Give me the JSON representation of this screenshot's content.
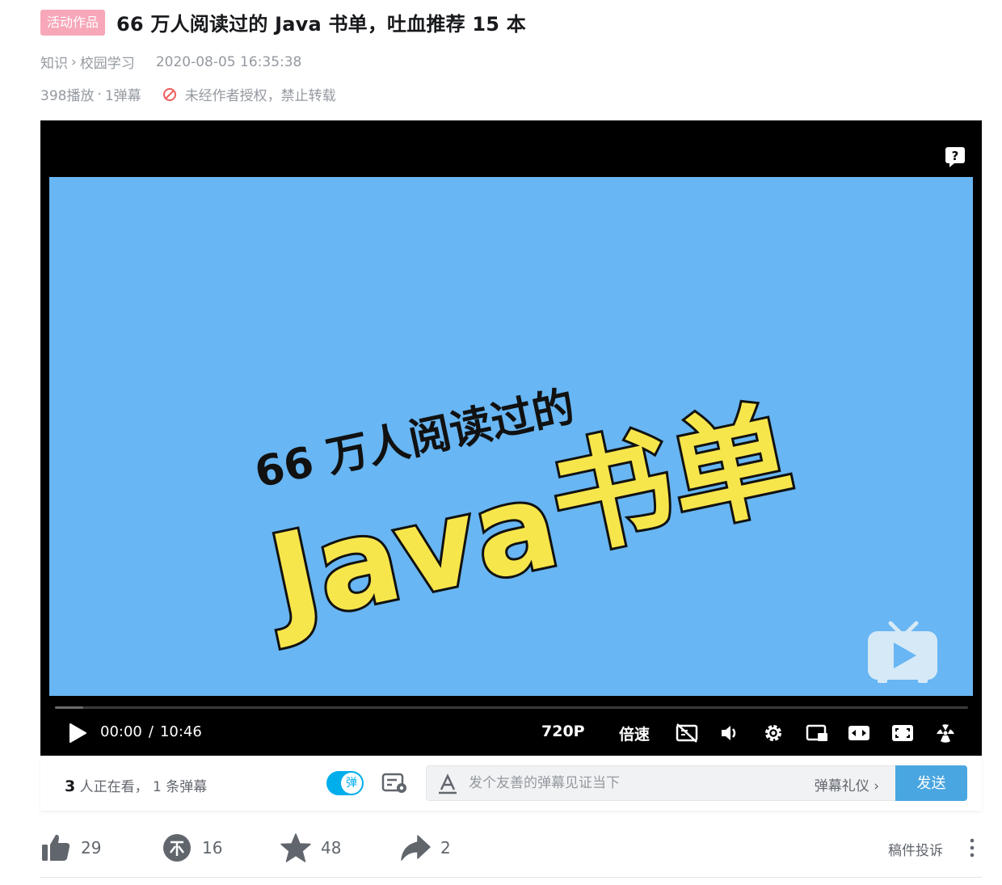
{
  "header": {
    "badge": "活动作品",
    "title": "66 万人阅读过的 Java 书单，吐血推荐 15 本"
  },
  "meta": {
    "category": "知识",
    "subcategory": "校园学习",
    "date": "2020-08-05 16:35:38"
  },
  "stats": {
    "plays": "398播放",
    "danmaku": "1弹幕",
    "copyright": "未经作者授权，禁止转载"
  },
  "cover": {
    "line1": "66 万人阅读过的",
    "line2a": "Java",
    "line2b": "书单",
    "background": "#68b6f3",
    "accent": "#f7e64b"
  },
  "player": {
    "current_time": "00:00",
    "duration": "10:46",
    "quality": "720P",
    "speed": "倍速",
    "progress": 0.0
  },
  "danmaku_bar": {
    "viewer_count": "3",
    "viewer_text": "人正在看，",
    "danmaku_count": "1 条弹幕",
    "toggle_label": "弹",
    "placeholder": "发个友善的弹幕见证当下",
    "etiquette": "弹幕礼仪 ›",
    "send": "发送"
  },
  "actions": {
    "likes": "29",
    "coins": "16",
    "favorites": "48",
    "shares": "2",
    "report": "稿件投诉"
  }
}
